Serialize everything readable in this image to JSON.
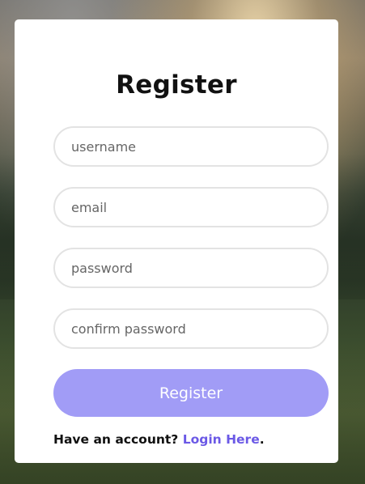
{
  "form": {
    "title": "Register",
    "username_placeholder": "username",
    "email_placeholder": "email",
    "password_placeholder": "password",
    "confirm_password_placeholder": "confirm password",
    "submit_label": "Register",
    "footer_text": "Have an account?",
    "login_link_label": "Login Here",
    "footer_suffix": "."
  },
  "colors": {
    "button": "#a19cf6",
    "link": "#6b59e6",
    "card": "#ffffff"
  }
}
